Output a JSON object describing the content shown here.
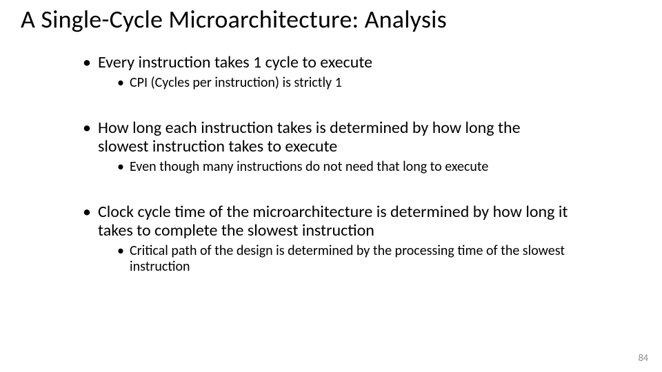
{
  "title": "A Single-Cycle Microarchitecture: Analysis",
  "bullets": [
    {
      "text": "Every instruction takes 1 cycle to execute",
      "sub": [
        "CPI (Cycles per instruction) is strictly 1"
      ]
    },
    {
      "text": "How long each instruction takes is determined by how long the slowest instruction takes to execute",
      "sub": [
        "Even though many instructions do not need that long to execute"
      ]
    },
    {
      "text": "Clock cycle time of the microarchitecture is determined by how long it takes to complete the slowest instruction",
      "sub": [
        "Critical path of the design is determined by the processing time of the slowest instruction"
      ]
    }
  ],
  "page_number": "84"
}
